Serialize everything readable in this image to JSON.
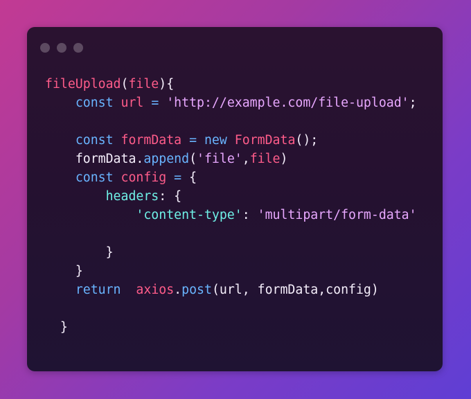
{
  "window": {
    "controls": [
      "close",
      "minimize",
      "maximize"
    ]
  },
  "colors": {
    "function": "#ff5c8a",
    "keyword": "#69b4ff",
    "string": "#e8a8ff",
    "property": "#6ff0e6",
    "plain": "#f5eefb"
  },
  "code": {
    "lines": [
      [
        {
          "t": "fileUpload",
          "c": "fn"
        },
        {
          "t": "(",
          "c": "plain"
        },
        {
          "t": "file",
          "c": "fn"
        },
        {
          "t": "){",
          "c": "plain"
        }
      ],
      [
        {
          "t": "    ",
          "c": "plain"
        },
        {
          "t": "const",
          "c": "kw"
        },
        {
          "t": " ",
          "c": "plain"
        },
        {
          "t": "url",
          "c": "fn"
        },
        {
          "t": " ",
          "c": "plain"
        },
        {
          "t": "=",
          "c": "kw"
        },
        {
          "t": " ",
          "c": "plain"
        },
        {
          "t": "'http://example.com/file-upload'",
          "c": "str"
        },
        {
          "t": ";",
          "c": "plain"
        }
      ],
      [],
      [
        {
          "t": "    ",
          "c": "plain"
        },
        {
          "t": "const",
          "c": "kw"
        },
        {
          "t": " ",
          "c": "plain"
        },
        {
          "t": "formData",
          "c": "fn"
        },
        {
          "t": " ",
          "c": "plain"
        },
        {
          "t": "=",
          "c": "kw"
        },
        {
          "t": " ",
          "c": "plain"
        },
        {
          "t": "new",
          "c": "kw"
        },
        {
          "t": " ",
          "c": "plain"
        },
        {
          "t": "FormData",
          "c": "fn"
        },
        {
          "t": "();",
          "c": "plain"
        }
      ],
      [
        {
          "t": "    ",
          "c": "plain"
        },
        {
          "t": "formData",
          "c": "plain"
        },
        {
          "t": ".",
          "c": "plain"
        },
        {
          "t": "append",
          "c": "kw"
        },
        {
          "t": "(",
          "c": "plain"
        },
        {
          "t": "'file'",
          "c": "str"
        },
        {
          "t": ",",
          "c": "plain"
        },
        {
          "t": "file",
          "c": "fn"
        },
        {
          "t": ")",
          "c": "plain"
        }
      ],
      [
        {
          "t": "    ",
          "c": "plain"
        },
        {
          "t": "const",
          "c": "kw"
        },
        {
          "t": " ",
          "c": "plain"
        },
        {
          "t": "config",
          "c": "fn"
        },
        {
          "t": " ",
          "c": "plain"
        },
        {
          "t": "=",
          "c": "kw"
        },
        {
          "t": " {",
          "c": "plain"
        }
      ],
      [
        {
          "t": "        ",
          "c": "plain"
        },
        {
          "t": "headers",
          "c": "prop"
        },
        {
          "t": ": {",
          "c": "plain"
        }
      ],
      [
        {
          "t": "            ",
          "c": "plain"
        },
        {
          "t": "'content-type'",
          "c": "prop"
        },
        {
          "t": ": ",
          "c": "plain"
        },
        {
          "t": "'multipart/form-data'",
          "c": "str"
        }
      ],
      [],
      [
        {
          "t": "        ",
          "c": "plain"
        },
        {
          "t": "}",
          "c": "plain"
        }
      ],
      [
        {
          "t": "    ",
          "c": "plain"
        },
        {
          "t": "}",
          "c": "plain"
        }
      ],
      [
        {
          "t": "    ",
          "c": "plain"
        },
        {
          "t": "return",
          "c": "kw"
        },
        {
          "t": "  ",
          "c": "plain"
        },
        {
          "t": "axios",
          "c": "fn"
        },
        {
          "t": ".",
          "c": "plain"
        },
        {
          "t": "post",
          "c": "kw"
        },
        {
          "t": "(url, formData,config)",
          "c": "plain"
        }
      ],
      [],
      [
        {
          "t": "  ",
          "c": "plain"
        },
        {
          "t": "}",
          "c": "plain"
        }
      ]
    ]
  }
}
